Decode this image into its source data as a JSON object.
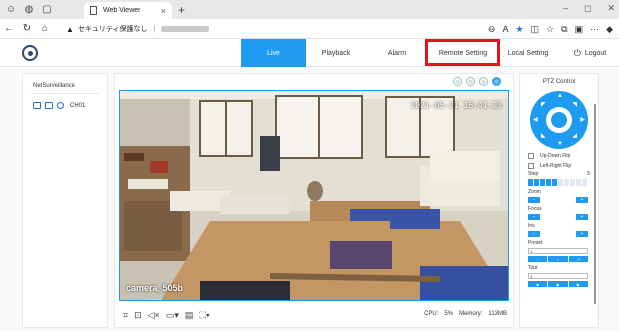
{
  "browser": {
    "tab_title": "Web Viewer",
    "new_tab": "+",
    "address_warning": "セキュリティ保護なし",
    "window_controls": [
      "–",
      "◻",
      "✕"
    ]
  },
  "nav": {
    "items": [
      "Live",
      "Playback",
      "Alarm",
      "Remote Setting",
      "Local Setting",
      "Logout"
    ],
    "active": "Live",
    "highlighted": "Remote Setting"
  },
  "left": {
    "title": "NetSurveillance",
    "channel": "CH01"
  },
  "video": {
    "timestamp": "2021-05-21 16:41:23",
    "camera_name": "camera_505b"
  },
  "stats": {
    "cpu_label": "CPU:",
    "cpu_value": "5%",
    "memory_label": "Memory:",
    "memory_value": "113MB"
  },
  "ptz": {
    "title": "PTZ Control",
    "updown": "Up-Down Flip",
    "leftright": "Left-Right Flip",
    "step_label": "Step",
    "step_value": "5",
    "step_level": 5,
    "step_max": 10,
    "zoom_label": "Zoom",
    "focus_label": "Focus",
    "iris_label": "Iris",
    "preset_label": "Preset",
    "preset_value": "1",
    "tour_label": "Tour",
    "tour_value": "1"
  },
  "colors": {
    "accent": "#1e9bf0",
    "highlight": "#e3121b"
  }
}
